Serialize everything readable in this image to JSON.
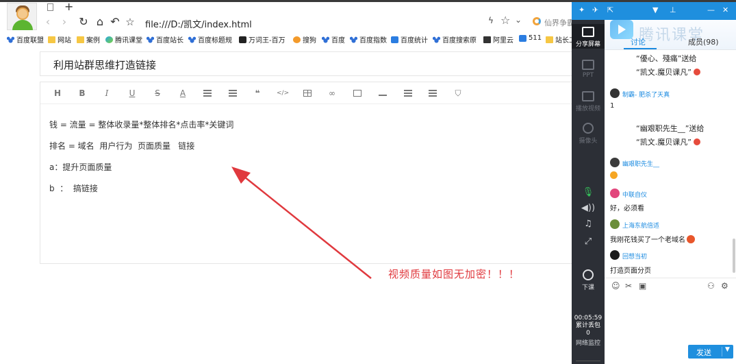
{
  "browser": {
    "url": "file:///D:/凯文/index.html",
    "search_hint": "仙界争霸",
    "new_tab": "+",
    "bookmarks": [
      {
        "label": "百度联盟",
        "icon": "paw"
      },
      {
        "label": "网站",
        "icon": "folder"
      },
      {
        "label": "案例",
        "icon": "folder"
      },
      {
        "label": "腾讯课堂",
        "icon": "tencent"
      },
      {
        "label": "百度站长",
        "icon": "paw"
      },
      {
        "label": "百度标题规",
        "icon": "paw"
      },
      {
        "label": "万词王-百万",
        "icon": "black"
      },
      {
        "label": "搜狗",
        "icon": "orange"
      },
      {
        "label": "百度",
        "icon": "paw"
      },
      {
        "label": "百度指数",
        "icon": "paw"
      },
      {
        "label": "百度统计",
        "icon": "blue"
      },
      {
        "label": "百度搜索原",
        "icon": "paw"
      },
      {
        "label": "阿里云",
        "icon": "cloud"
      },
      {
        "label": "511",
        "icon": "blue"
      },
      {
        "label": "站长工",
        "icon": "folder"
      }
    ]
  },
  "page": {
    "title": "利用站群思维打造链接",
    "toolbar": [
      "H",
      "B",
      "I",
      "U",
      "S",
      "A",
      "ordered-list",
      "unordered-list",
      "quote",
      "</>",
      "table",
      "link",
      "image",
      "hr",
      "indent",
      "outdent",
      "html5"
    ],
    "lines": [
      "钱 = 流量 = 整体收录量*整体排名*点击率*关键词",
      "排名 = 域名  用户行为  页面质量   链接",
      "a：提升页面质量",
      "b  ：  搞链接"
    ],
    "annotation": "视频质量如图无加密！！！",
    "annotation_color": "#e0393e"
  },
  "tencent": {
    "brand": "腾讯课堂",
    "tabs": {
      "discuss": "讨论",
      "members": "成员(98)"
    },
    "side": {
      "share_screen": "分享屏幕",
      "ppt": "PPT",
      "play_video": "播放视频",
      "camera": "摄像头",
      "leave": "下课",
      "timer": "00:05:59",
      "packet_loss_label": "累计丢包",
      "packet_loss_value": "0",
      "net_monitor": "网络监控"
    },
    "chat": {
      "gift1_from": "“優心、殘痛”送给",
      "gift1_to": "“凯文.魔贝课凡”",
      "u1_name": "制霸- 肥杀了天真",
      "u1_msg": "1",
      "gift2_from": "“幽艰职先生__”送给",
      "gift2_to": "“凯文.魔贝课凡”",
      "u2_name": "幽艰职先生__",
      "u3_name": "中联自仪",
      "u3_msg": "好，必须看",
      "u4_name": "上海东航倍适",
      "u4_msg": "我刚花钱买了一个老域名",
      "u5_name": "回想当初",
      "u5_msg": "打造页面分页"
    },
    "send_label": "发送",
    "accent": "#1f8fde"
  }
}
